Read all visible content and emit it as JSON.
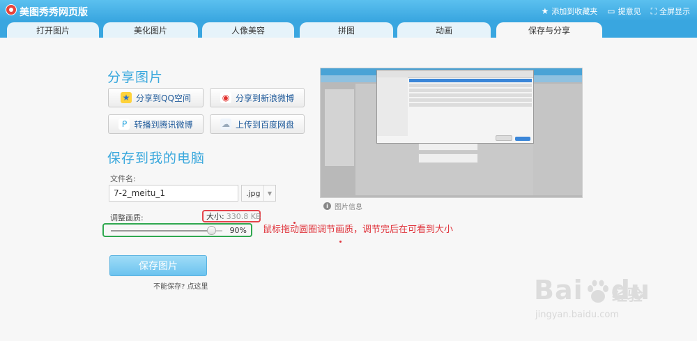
{
  "app": {
    "title": "美图秀秀网页版",
    "top_links": [
      {
        "icon": "star-icon",
        "label": "添加到收藏夹"
      },
      {
        "icon": "feedback-icon",
        "label": "提意见"
      },
      {
        "icon": "fullscreen-icon",
        "label": "全屏显示"
      }
    ]
  },
  "tabs": [
    {
      "label": "打开图片",
      "active": false
    },
    {
      "label": "美化图片",
      "active": false
    },
    {
      "label": "人像美容",
      "active": false
    },
    {
      "label": "拼图",
      "active": false
    },
    {
      "label": "动画",
      "active": false
    },
    {
      "label": "保存与分享",
      "active": true
    }
  ],
  "share": {
    "heading": "分享图片",
    "buttons": [
      {
        "icon": "qzone-star-icon",
        "label": "分享到QQ空间"
      },
      {
        "icon": "weibo-icon",
        "label": "分享到新浪微博"
      },
      {
        "icon": "tencent-weibo-icon",
        "label": "转播到腾讯微博"
      },
      {
        "icon": "baidu-cloud-icon",
        "label": "上传到百度网盘"
      }
    ]
  },
  "save": {
    "heading": "保存到我的电脑",
    "filename_label": "文件名:",
    "filename_value": "7-2_meitu_1",
    "extension": ".jpg",
    "quality_label": "调整画质:",
    "size_key": "大小:",
    "size_value": "330.8 KB",
    "quality_fraction": 0.9,
    "quality_percent": "90%",
    "annotation": "鼠标拖动圆圈调节画质，调节完后在可看到大小",
    "save_button": "保存图片",
    "cant_save": "不能保存? 点这里"
  },
  "preview": {
    "image_info": "图片信息"
  },
  "watermark": {
    "brand": "Bai",
    "brand_tail": "du",
    "cn": "经验",
    "url": "jingyan.baidu.com"
  },
  "colors": {
    "accent": "#3aa8dd",
    "annotation_red": "#e0353d",
    "highlight_green": "#2fa84f",
    "highlight_red": "#e4444c"
  }
}
